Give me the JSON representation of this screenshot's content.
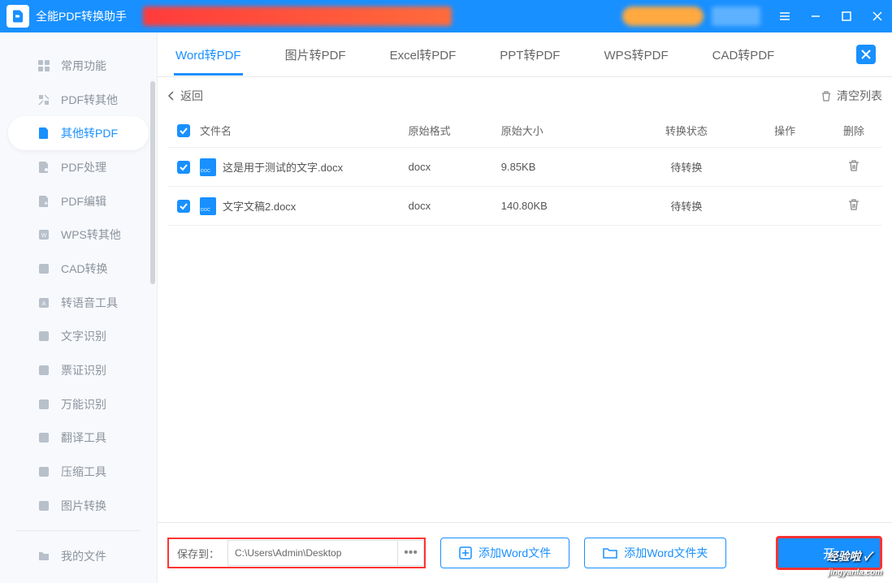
{
  "app": {
    "title": "全能PDF转换助手"
  },
  "sidebar": {
    "items": [
      {
        "label": "常用功能"
      },
      {
        "label": "PDF转其他"
      },
      {
        "label": "其他转PDF"
      },
      {
        "label": "PDF处理"
      },
      {
        "label": "PDF编辑"
      },
      {
        "label": "WPS转其他"
      },
      {
        "label": "CAD转换"
      },
      {
        "label": "转语音工具"
      },
      {
        "label": "文字识别"
      },
      {
        "label": "票证识别"
      },
      {
        "label": "万能识别"
      },
      {
        "label": "翻译工具"
      },
      {
        "label": "压缩工具"
      },
      {
        "label": "图片转换"
      }
    ],
    "my_files": "我的文件"
  },
  "tabs": [
    {
      "label": "Word转PDF"
    },
    {
      "label": "图片转PDF"
    },
    {
      "label": "Excel转PDF"
    },
    {
      "label": "PPT转PDF"
    },
    {
      "label": "WPS转PDF"
    },
    {
      "label": "CAD转PDF"
    }
  ],
  "toolbar": {
    "back": "返回",
    "clear": "清空列表"
  },
  "table": {
    "headers": {
      "name": "文件名",
      "format": "原始格式",
      "size": "原始大小",
      "status": "转换状态",
      "op": "操作",
      "del": "删除"
    },
    "rows": [
      {
        "name": "这是用于测试的文字.docx",
        "format": "docx",
        "size": "9.85KB",
        "status": "待转换"
      },
      {
        "name": "文字文稿2.docx",
        "format": "docx",
        "size": "140.80KB",
        "status": "待转换"
      }
    ]
  },
  "footer": {
    "save_label": "保存到：",
    "save_path": "C:\\Users\\Admin\\Desktop",
    "add_file": "添加Word文件",
    "add_folder": "添加Word文件夹",
    "start": "开"
  },
  "watermark": {
    "line1": "经验啦 ✓",
    "line2": "jingyanla.com"
  }
}
